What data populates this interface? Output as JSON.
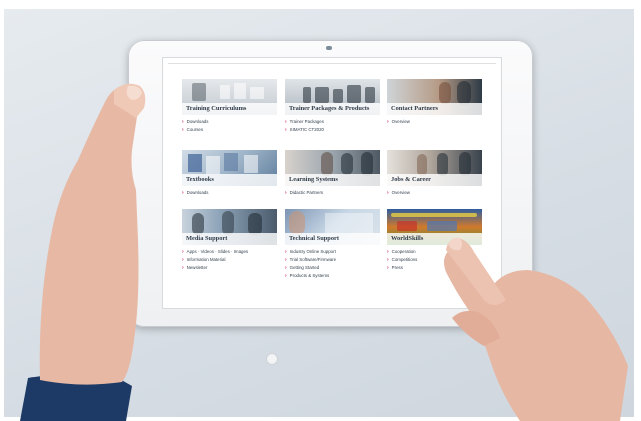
{
  "tiles": [
    {
      "title": "Training Curriculums",
      "links": [
        "Downloads",
        "Courses"
      ]
    },
    {
      "title": "Trainer Packages & Products",
      "links": [
        "Trainer Packages",
        "SIMATIC CT2020"
      ]
    },
    {
      "title": "Contact Partners",
      "links": [
        "Overview"
      ]
    },
    {
      "title": "Textbooks",
      "links": [
        "Downloads"
      ]
    },
    {
      "title": "Learning Systems",
      "links": [
        "Didactic Partners"
      ]
    },
    {
      "title": "Jobs & Career",
      "links": [
        "Overview"
      ]
    },
    {
      "title": "Media Support",
      "links": [
        "Apps · Videos · Slides · Images",
        "Information Material",
        "Newsletter"
      ]
    },
    {
      "title": "Technical Support",
      "links": [
        "Industry Online Support",
        "Trial Software/Firmware",
        "Getting Started",
        "Products & Systems"
      ]
    },
    {
      "title": "WorldSkills",
      "links": [
        "Cooperation",
        "Competitions",
        "Press"
      ]
    }
  ],
  "colors": {
    "accent": "#c6123d",
    "text": "#33414e",
    "background": "#dde3e9"
  }
}
